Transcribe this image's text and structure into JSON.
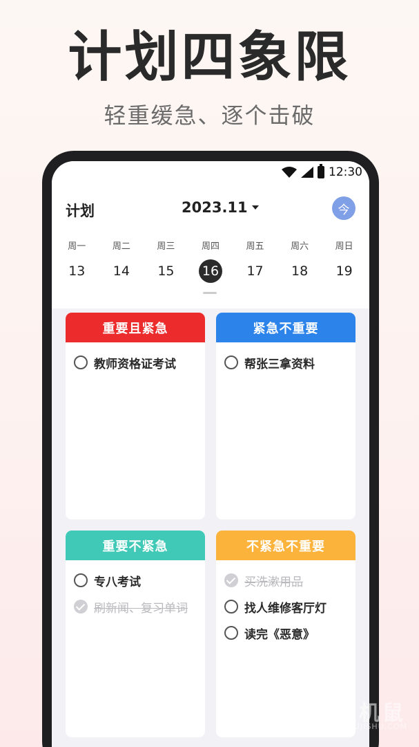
{
  "hero": {
    "title": "计划四象限",
    "subtitle": "轻重缓急、逐个击破"
  },
  "status": {
    "time": "12:30"
  },
  "header": {
    "title": "计划",
    "month": "2023.11",
    "today_label": "今"
  },
  "week": [
    {
      "name": "周一",
      "num": "13"
    },
    {
      "name": "周二",
      "num": "14"
    },
    {
      "name": "周三",
      "num": "15"
    },
    {
      "name": "周四",
      "num": "16",
      "active": true
    },
    {
      "name": "周五",
      "num": "17"
    },
    {
      "name": "周六",
      "num": "18"
    },
    {
      "name": "周日",
      "num": "19"
    }
  ],
  "quadrants": {
    "q1": {
      "title": "重要且紧急",
      "color": "#ec2c2c",
      "tasks": [
        {
          "text": "教师资格证考试",
          "done": false
        }
      ]
    },
    "q2": {
      "title": "紧急不重要",
      "color": "#2c83ea",
      "tasks": [
        {
          "text": "帮张三拿资料",
          "done": false
        }
      ]
    },
    "q3": {
      "title": "重要不紧急",
      "color": "#3fc9b6",
      "tasks": [
        {
          "text": "专八考试",
          "done": false
        },
        {
          "text": "刷新闻、复习单词",
          "done": true
        }
      ]
    },
    "q4": {
      "title": "不紧急不重要",
      "color": "#fbb33c",
      "tasks": [
        {
          "text": "买洗漱用品",
          "done": true
        },
        {
          "text": "找人维修客厅灯",
          "done": false
        },
        {
          "text": "读完《恶意》",
          "done": false
        }
      ]
    }
  },
  "watermark": {
    "main": "手机鼠",
    "sub": "SHOUJISHU.COM"
  }
}
